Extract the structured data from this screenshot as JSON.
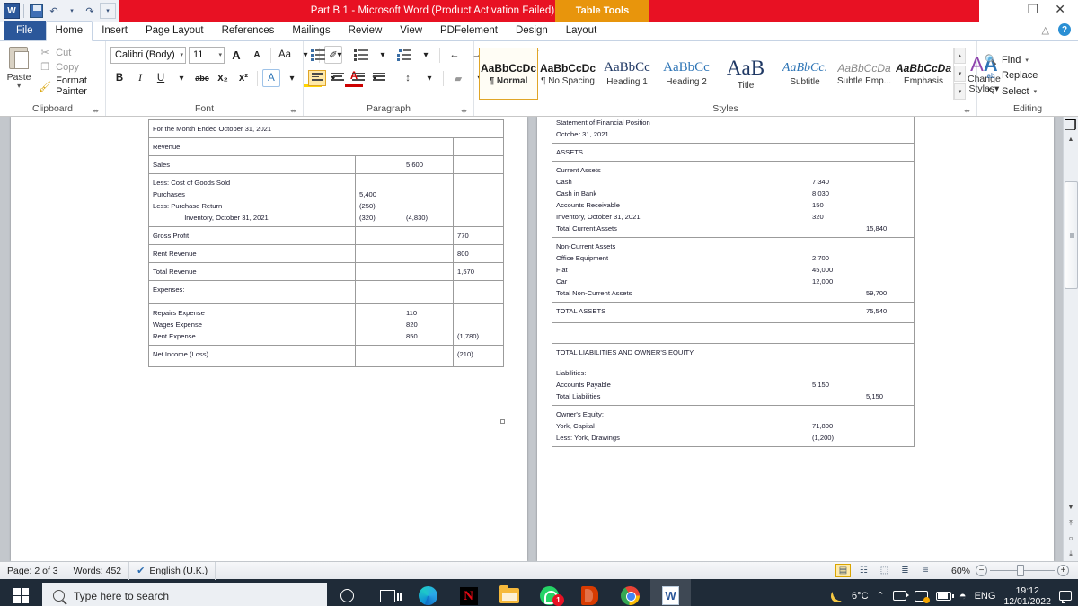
{
  "window": {
    "title": "Part B 1  -  Microsoft Word (Product Activation Failed)",
    "contextual_tab_group": "Table Tools",
    "restore_label": "❐",
    "close_label": "✕",
    "qat": [
      {
        "name": "word-logo",
        "label": "W"
      },
      {
        "name": "save",
        "label": ""
      },
      {
        "name": "undo",
        "label": "↶"
      },
      {
        "name": "undo-dropdown",
        "label": "▾"
      },
      {
        "name": "redo",
        "label": "↷"
      },
      {
        "name": "customize-qat",
        "label": "▾"
      }
    ]
  },
  "ribbon": {
    "tabs": [
      {
        "label": "File",
        "type": "file"
      },
      {
        "label": "Home",
        "type": "active"
      },
      {
        "label": "Insert",
        "type": "normal"
      },
      {
        "label": "Page Layout",
        "type": "normal"
      },
      {
        "label": "References",
        "type": "normal"
      },
      {
        "label": "Mailings",
        "type": "normal"
      },
      {
        "label": "Review",
        "type": "normal"
      },
      {
        "label": "View",
        "type": "normal"
      },
      {
        "label": "PDFelement",
        "type": "normal"
      },
      {
        "label": "Design",
        "type": "tabletools"
      },
      {
        "label": "Layout",
        "type": "tabletools"
      }
    ],
    "minimize_ribbon_label": "△",
    "help_label": "?",
    "clipboard": {
      "group_label": "Clipboard",
      "paste_label": "Paste",
      "paste_caret": "▾",
      "cut_label": "Cut",
      "copy_label": "Copy",
      "format_painter_label": "Format Painter",
      "cut_icon": "✂",
      "copy_icon": "❐",
      "format_painter_icon": "🖌",
      "launcher": "⬌"
    },
    "font": {
      "group_label": "Font",
      "font_name": "Calibri (Body)",
      "font_size": "11",
      "grow_font": "A",
      "shrink_font": "A",
      "change_case": "Aa",
      "clear_formatting": "✐",
      "bold": "B",
      "italic": "I",
      "underline": "U",
      "strikethrough": "abc",
      "subscript": "x₂",
      "superscript": "x²",
      "text_effects": "A",
      "highlight": "✎",
      "font_color": "A",
      "caret": "▾",
      "launcher": "⬌"
    },
    "paragraph": {
      "group_label": "Paragraph",
      "bullets": "≡",
      "numbering": "≡",
      "multilevel": "≡",
      "decrease_indent": "←",
      "increase_indent": "→",
      "sort": "A↓",
      "show_marks": "¶",
      "align_left": "align-left",
      "align_center": "align-center",
      "align_right": "align-right",
      "justify": "justify",
      "line_spacing": "↕",
      "shading": "▰",
      "borders": "⊞",
      "caret": "▾",
      "launcher": "⬌"
    },
    "styles": {
      "group_label": "Styles",
      "items": [
        {
          "preview": "AaBbCcDc",
          "name": "¶ Normal",
          "selected": true
        },
        {
          "preview": "AaBbCcDc",
          "name": "¶ No Spacing",
          "selected": false
        },
        {
          "preview": "AaBbCc",
          "name": "Heading 1",
          "selected": false
        },
        {
          "preview": "AaBbCc",
          "name": "Heading 2",
          "selected": false
        },
        {
          "preview": "AaB",
          "name": "Title",
          "selected": false
        },
        {
          "preview": "AaBbCc.",
          "name": "Subtitle",
          "selected": false
        },
        {
          "preview": "AaBbCcDa",
          "name": "Subtle Emp...",
          "selected": false
        },
        {
          "preview": "AaBbCcDa",
          "name": "Emphasis",
          "selected": false
        }
      ],
      "scroll_up": "▴",
      "scroll_down": "▾",
      "more": "▾",
      "change_styles_label": "Change",
      "change_styles_label2": "Styles",
      "change_styles_caret": "▾",
      "launcher": "⬌"
    },
    "editing": {
      "group_label": "Editing",
      "find_label": "Find",
      "replace_label": "Replace",
      "select_label": "Select",
      "find_icon": "🔍",
      "replace_icon": "ab",
      "select_icon": "↖",
      "caret": "▾"
    }
  },
  "document": {
    "left_page": {
      "rows": [
        {
          "cells": [
            {
              "text": "For the Month Ended October 31, 2021",
              "span": 4,
              "type": "label"
            }
          ]
        },
        {
          "cells": [
            {
              "text": "Revenue",
              "span": 3,
              "type": "label"
            },
            {
              "text": "",
              "type": "num"
            }
          ]
        },
        {
          "cells": [
            {
              "text": "Sales",
              "type": "label"
            },
            {
              "text": "",
              "type": "num"
            },
            {
              "text": "5,600",
              "type": "num"
            },
            {
              "text": "",
              "type": "num"
            }
          ]
        },
        {
          "cells": [
            {
              "text": "Less: Cost of Goods Sold\nPurchases\nLess: Purchase Return\n  Inventory, October 31, 2021",
              "type": "multi-label"
            },
            {
              "text": "\n5,400\n(250)\n(320)",
              "type": "multi-num"
            },
            {
              "text": "\n\n\n(4,830)",
              "type": "multi-num"
            },
            {
              "text": "",
              "type": "num"
            }
          ]
        },
        {
          "cells": [
            {
              "text": "Gross Profit",
              "type": "label"
            },
            {
              "text": "",
              "type": "num"
            },
            {
              "text": "",
              "type": "num"
            },
            {
              "text": "770",
              "type": "num"
            }
          ]
        },
        {
          "cells": [
            {
              "text": "Rent Revenue",
              "type": "label"
            },
            {
              "text": "",
              "type": "num"
            },
            {
              "text": "",
              "type": "num"
            },
            {
              "text": "800",
              "type": "num"
            }
          ]
        },
        {
          "cells": [
            {
              "text": "Total Revenue",
              "type": "label"
            },
            {
              "text": "",
              "type": "num"
            },
            {
              "text": "",
              "type": "num"
            },
            {
              "text": "1,570",
              "type": "num"
            }
          ]
        },
        {
          "cells": [
            {
              "text": "Expenses:",
              "type": "label"
            },
            {
              "text": "",
              "type": "num"
            },
            {
              "text": "",
              "type": "num"
            },
            {
              "text": "",
              "type": "num"
            }
          ]
        },
        {
          "cells": [
            {
              "text": "Repairs Expense\nWages Expense\nRent Expense",
              "type": "multi-label"
            },
            {
              "text": "",
              "type": "num"
            },
            {
              "text": "110\n820\n850",
              "type": "multi-num"
            },
            {
              "text": "\n\n(1,780)",
              "type": "multi-num"
            }
          ]
        },
        {
          "cells": [
            {
              "text": "Net Income (Loss)",
              "type": "label"
            },
            {
              "text": "",
              "type": "num"
            },
            {
              "text": "",
              "type": "num"
            },
            {
              "text": "(210)",
              "type": "num"
            }
          ]
        }
      ]
    },
    "right_page": {
      "rows": [
        {
          "cells": [
            {
              "text": "Statement of Financial Position\nOctober 31, 2021",
              "span": 3,
              "type": "multi-label"
            }
          ]
        },
        {
          "cells": [
            {
              "text": "ASSETS",
              "span": 3,
              "type": "label"
            }
          ]
        },
        {
          "cells": [
            {
              "text": "Current Assets\nCash\nCash in Bank\nAccounts Receivable\nInventory, October 31, 2021\nTotal Current Assets",
              "type": "multi-label"
            },
            {
              "text": "\n7,340\n8,030\n150\n320",
              "type": "multi-num"
            },
            {
              "text": "\n\n\n\n\n15,840",
              "type": "multi-num"
            }
          ]
        },
        {
          "cells": [
            {
              "text": "Non-Current Assets\nOffice Equipment\nFlat\nCar\nTotal Non-Current Assets",
              "type": "multi-label"
            },
            {
              "text": "\n2,700\n45,000\n12,000",
              "type": "multi-num"
            },
            {
              "text": "\n\n\n\n59,700",
              "type": "multi-num"
            }
          ]
        },
        {
          "cells": [
            {
              "text": "TOTAL ASSETS",
              "type": "label"
            },
            {
              "text": "",
              "type": "num"
            },
            {
              "text": "75,540",
              "type": "num"
            }
          ]
        },
        {
          "cells": [
            {
              "text": "",
              "type": "label"
            },
            {
              "text": "",
              "type": "num"
            },
            {
              "text": "",
              "type": "num"
            }
          ]
        },
        {
          "cells": [
            {
              "text": "TOTAL LIABILITIES AND OWNER'S EQUITY",
              "type": "label"
            },
            {
              "text": "",
              "type": "num"
            },
            {
              "text": "",
              "type": "num"
            }
          ]
        },
        {
          "cells": [
            {
              "text": "Liabilities:\nAccounts Payable\nTotal Liabilities",
              "type": "multi-label"
            },
            {
              "text": "\n5,150",
              "type": "multi-num"
            },
            {
              "text": "\n\n5,150",
              "type": "multi-num"
            }
          ]
        },
        {
          "cells": [
            {
              "text": "Owner's Equity:\nYork, Capital\nLess: York, Drawings",
              "type": "multi-label"
            },
            {
              "text": "\n71,800\n(1,200)",
              "type": "multi-num"
            },
            {
              "text": "",
              "type": "num"
            }
          ]
        }
      ]
    }
  },
  "statusbar": {
    "page": "Page: 2 of 3",
    "words": "Words: 452",
    "language": "English (U.K.)",
    "proofing_icon": "✔",
    "zoom": "60%",
    "zoom_out": "−",
    "zoom_in": "+",
    "views": [
      {
        "name": "print-layout",
        "glyph": "▤",
        "selected": true
      },
      {
        "name": "full-screen-reading",
        "glyph": "☷",
        "selected": false
      },
      {
        "name": "web-layout",
        "glyph": "⬚",
        "selected": false
      },
      {
        "name": "outline",
        "glyph": "≣",
        "selected": false
      },
      {
        "name": "draft",
        "glyph": "≡",
        "selected": false
      }
    ]
  },
  "scrollbar": {
    "up_arrow": "▲",
    "down_arrow": "▼",
    "previous_page": "⤒",
    "select_browse_object": "○",
    "next_page": "⤓",
    "browse_icon": "❐"
  },
  "taskbar": {
    "search_placeholder": "Type here to search",
    "icons": [
      {
        "name": "cortana",
        "label": "Cortana"
      },
      {
        "name": "task-view",
        "label": "Task View"
      },
      {
        "name": "microsoft-edge",
        "label": "Microsoft Edge"
      },
      {
        "name": "netflix",
        "label": "Netflix"
      },
      {
        "name": "file-explorer",
        "label": "File Explorer"
      },
      {
        "name": "whatsapp",
        "label": "WhatsApp",
        "badge": "1"
      },
      {
        "name": "microsoft-office",
        "label": "Office"
      },
      {
        "name": "google-chrome",
        "label": "Google Chrome"
      },
      {
        "name": "microsoft-word",
        "label": "Microsoft Word",
        "active": true
      }
    ],
    "tray": {
      "weather_temp": "6°C",
      "show_hidden": "⌃",
      "language": "ENG",
      "time": "19:12",
      "date": "12/01/2022"
    }
  }
}
